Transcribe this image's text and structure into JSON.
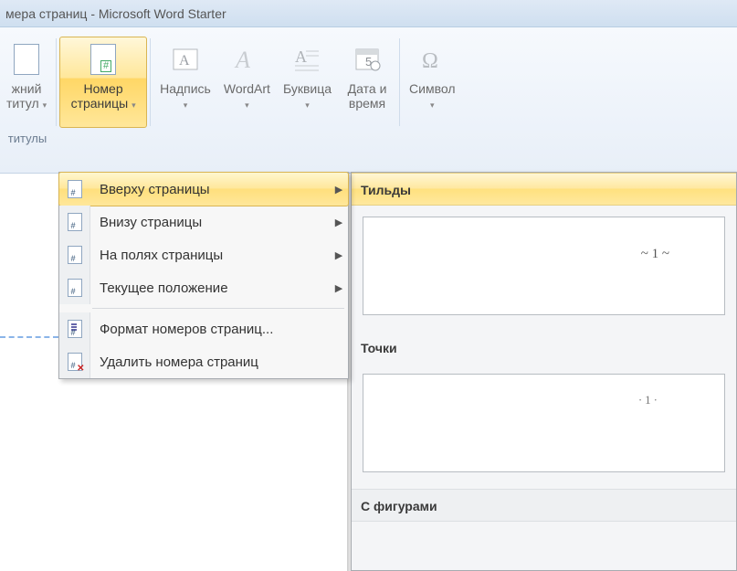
{
  "titlebar": {
    "text": "мера страниц  -  Microsoft Word Starter"
  },
  "ribbon": {
    "buttons": {
      "footer_partial": {
        "label_line1": "жний",
        "label_line2": "титул"
      },
      "page_number": {
        "label_line1": "Номер",
        "label_line2": "страницы"
      },
      "text_box": {
        "label_line1": "Надпись"
      },
      "wordart": {
        "label_line1": "WordArt"
      },
      "drop_cap": {
        "label_line1": "Буквица"
      },
      "date_time": {
        "label_line1": "Дата и",
        "label_line2": "время"
      },
      "symbol": {
        "label_line1": "Символ"
      }
    },
    "group_label_left": "титулы"
  },
  "menu": {
    "items": [
      {
        "label": "Вверху страницы",
        "has_sub": true
      },
      {
        "label": "Внизу страницы",
        "has_sub": true
      },
      {
        "label": "На полях страницы",
        "has_sub": true
      },
      {
        "label": "Текущее положение",
        "has_sub": true
      }
    ],
    "format": "Формат номеров страниц...",
    "remove": "Удалить номера страниц"
  },
  "gallery": {
    "cat1": "Тильды",
    "cat1_sample": "~ 1 ~",
    "cat2": "Точки",
    "cat2_sample": "·1·",
    "cat3": "С фигурами"
  }
}
